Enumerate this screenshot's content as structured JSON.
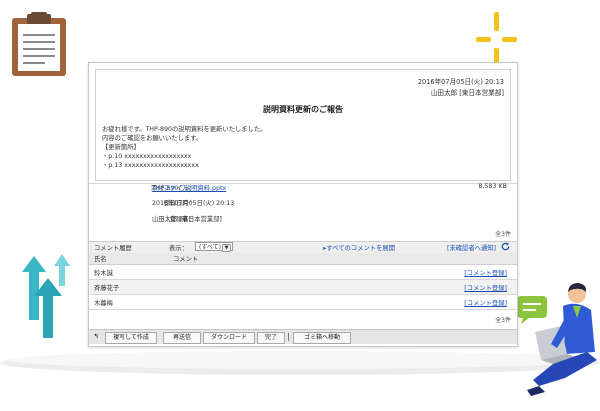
{
  "message": {
    "date": "2016年07月05日(火) 20:13",
    "author": "山田太郎 [東日本営業部]",
    "title": "説明資料更新のご報告",
    "body": [
      "お疲れ様です。THP-890の説明資料を更新いたしました。",
      "内容のご確認をお願いいたします。",
      "【更新箇所】",
      "・p.10 xxxxxxxxxxxxxxxxxx",
      "・p.13 xxxxxxxxxxxxxxxxxxxx"
    ]
  },
  "info": {
    "attachment_label": "添付ファイル：",
    "attachment_name": "THP-890ご説明資料.pptx",
    "attachment_size": "8,583 KB",
    "registered_date_label": "登録日時：",
    "registered_date": "2016年07月05日(火) 20:13",
    "registrant_label": "登録者：",
    "registrant": "山田太郎 [東日本営業部]",
    "total": "全3件"
  },
  "comments": {
    "section_title": "コメント履歴",
    "filter_label": "表示：",
    "filter_value": "(すべて)",
    "expand_all": "▸すべてのコメントを展開",
    "notify_unconfirmed": "[未確認者へ通知]",
    "col_name": "氏名",
    "col_comment": "コメント",
    "register_label": "[コメント登録]",
    "rows": [
      {
        "name": "鈴木誠"
      },
      {
        "name": "斉藤花子"
      },
      {
        "name": "木暮梅"
      }
    ],
    "total": "全3件"
  },
  "toolbar": {
    "back": "↰",
    "copy_create": "複写して作成",
    "resend": "再送信",
    "download": "ダウンロード",
    "done": "完了",
    "trash": "ゴミ箱へ移動"
  },
  "colors": {
    "link": "#1a4fb0",
    "accent_yellow": "#f2c418",
    "arrow_teal": "#3bb6c4",
    "bubble_green": "#8cc63f",
    "person_blue": "#2f5bd6"
  }
}
